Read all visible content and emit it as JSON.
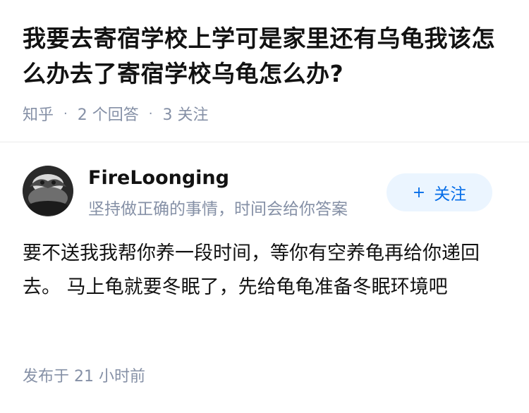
{
  "question": {
    "title": "我要去寄宿学校上学可是家里还有乌龟我该怎么办去了寄宿学校乌龟怎么办?",
    "meta": {
      "source": "知乎",
      "answers": "2 个回答",
      "followers": "3 关注"
    }
  },
  "answer": {
    "author": {
      "name": "FireLoonging",
      "bio": "坚持做正确的事情，时间会给你答案"
    },
    "follow_button": {
      "icon": "plus-icon",
      "plus": "+",
      "label": "关注"
    },
    "content": "要不送我我帮你养一段时间，等你有空养龟再给你递回去。 马上龟就要冬眠了，先给龟龟准备冬眠环境吧",
    "published": "发布于 21 小时前"
  },
  "colors": {
    "title": "#121212",
    "meta": "#8590a6",
    "accent": "#056de8",
    "follow_bg": "#ebf5ff",
    "divider": "#ebebeb"
  }
}
